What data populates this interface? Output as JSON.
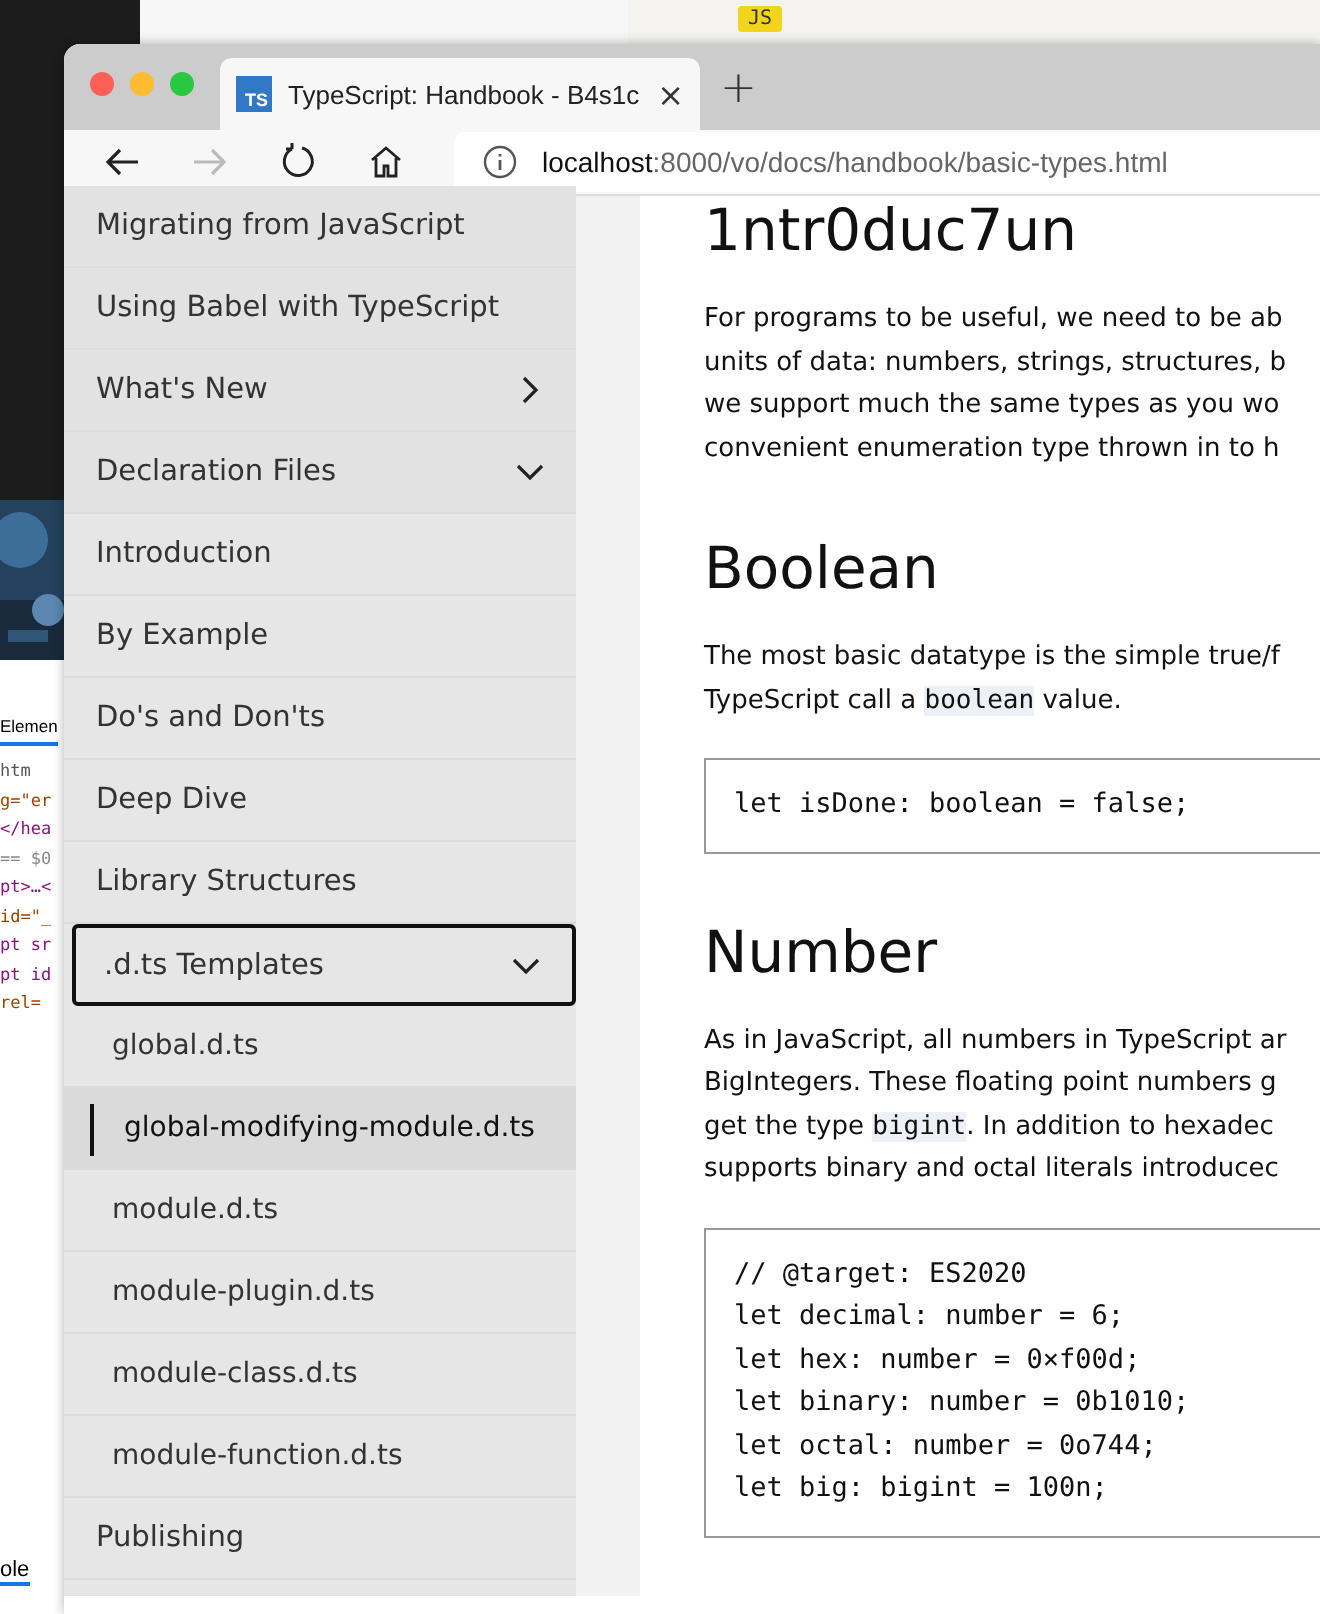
{
  "background": {
    "badge": "JS",
    "devtools": {
      "tab": "Elemen",
      "lines": [
        {
          "text": "htm",
          "color": "#555555"
        },
        {
          "text": "g=\"er",
          "color": "#994500"
        },
        {
          "text": "</hea",
          "color": "#881280"
        },
        {
          "text": "== $0",
          "color": "#888888"
        },
        {
          "text": "pt>…<",
          "color": "#881280"
        },
        {
          "text": "id=\"_",
          "color": "#994500"
        },
        {
          "text": "pt sr",
          "color": "#881280"
        },
        {
          "text": "pt id",
          "color": "#881280"
        },
        {
          "text": "rel=",
          "color": "#994500"
        }
      ],
      "bottom_tab": "ole"
    }
  },
  "browser": {
    "tab": {
      "title": "TypeScript: Handbook - B4s1c",
      "favicon": "TS",
      "close": "×"
    },
    "new_tab": "+",
    "toolbar": {
      "back_disabled": false,
      "forward_disabled": true,
      "url_host": "localhost",
      "url_path": ":8000/vo/docs/handbook/basic-types.html"
    }
  },
  "sidebar": {
    "items": [
      {
        "label": "Migrating from JavaScript",
        "selected": false
      },
      {
        "label": "Using Babel with TypeScript",
        "selected": false
      },
      {
        "label": "What's New",
        "selected": false,
        "expanded": false
      },
      {
        "label": "Declaration Files",
        "selected": false,
        "expanded": true,
        "children": [
          {
            "label": "Introduction",
            "selected": false
          },
          {
            "label": "By Example",
            "selected": false
          },
          {
            "label": "Do's and Don'ts",
            "selected": false
          },
          {
            "label": "Deep Dive",
            "selected": false
          },
          {
            "label": "Library Structures",
            "selected": false
          },
          {
            "label": ".d.ts Templates",
            "selected": false,
            "focused": true,
            "expanded": true,
            "children": [
              {
                "label": "global.d.ts",
                "selected": false
              },
              {
                "label": "global-modifying-module.d.ts",
                "selected": true
              },
              {
                "label": "module.d.ts",
                "selected": false
              },
              {
                "label": "module-plugin.d.ts",
                "selected": false
              },
              {
                "label": "module-class.d.ts",
                "selected": false
              },
              {
                "label": "module-function.d.ts",
                "selected": false
              }
            ]
          },
          {
            "label": "Publishing",
            "selected": false
          }
        ]
      }
    ]
  },
  "content": {
    "sections": [
      {
        "heading": "1ntr0duc7un",
        "paragraph": [
          [
            {
              "kind": "text",
              "text": "For programs to be useful, we need to be ab"
            }
          ],
          [
            {
              "kind": "text",
              "text": "units of data: numbers, strings, structures, b"
            }
          ],
          [
            {
              "kind": "text",
              "text": "we support much the same types as you wo"
            }
          ],
          [
            {
              "kind": "text",
              "text": "convenient enumeration type thrown in to h"
            }
          ]
        ]
      },
      {
        "heading": "Boolean",
        "paragraph": [
          [
            {
              "kind": "text",
              "text": "The most basic datatype is the simple true/f"
            }
          ],
          [
            {
              "kind": "text",
              "text": "TypeScript call a "
            },
            {
              "kind": "code",
              "text": "boolean"
            },
            {
              "kind": "text",
              "text": " value."
            }
          ]
        ],
        "code": [
          "let isDone: boolean = false;"
        ]
      },
      {
        "heading": "Number",
        "paragraph": [
          [
            {
              "kind": "text",
              "text": "As in JavaScript, all numbers in TypeScript ar"
            }
          ],
          [
            {
              "kind": "text",
              "text": "BigIntegers. These floating point numbers g"
            }
          ],
          [
            {
              "kind": "text",
              "text": "get the type "
            },
            {
              "kind": "code",
              "text": "bigint"
            },
            {
              "kind": "text",
              "text": ". In addition to hexadec"
            }
          ],
          [
            {
              "kind": "text",
              "text": "supports binary and octal literals introducec"
            }
          ]
        ],
        "code": [
          "// @target: ES2020",
          "let decimal: number = 6;",
          "let hex: number = 0×f00d;",
          "let binary: number = 0b1010;",
          "let octal: number = 0o744;",
          "let big: bigint = 100n;"
        ]
      }
    ]
  }
}
